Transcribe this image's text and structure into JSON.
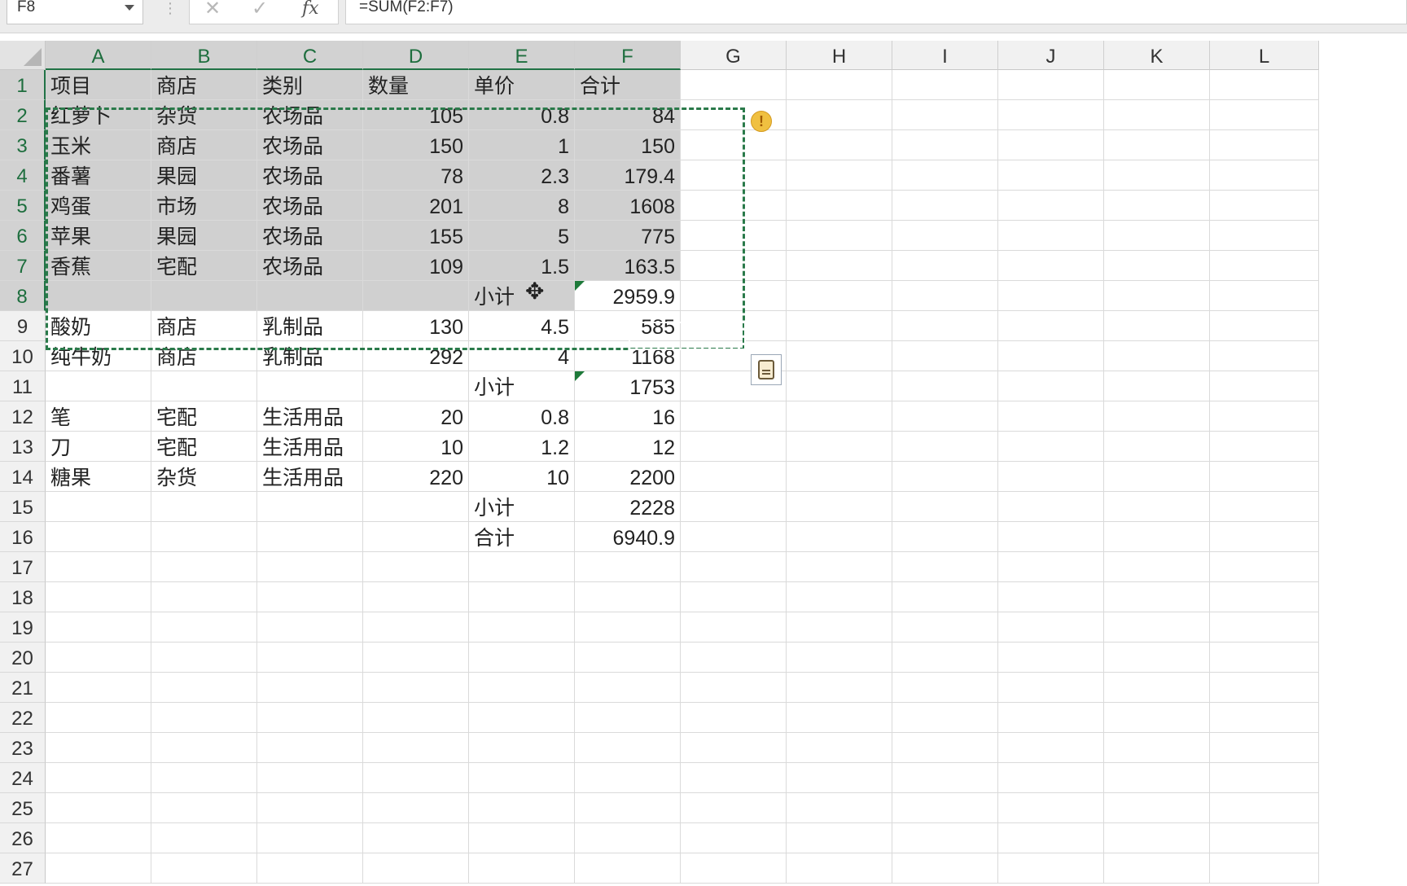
{
  "formula_bar": {
    "name_box": "F8",
    "formula": "=SUM(F2:F7)",
    "cancel_icon": "cross-icon",
    "enter_icon": "check-icon",
    "fx_label": "fx"
  },
  "columns": [
    "A",
    "B",
    "C",
    "D",
    "E",
    "F",
    "G",
    "H",
    "I",
    "J",
    "K",
    "L"
  ],
  "rows": [
    "1",
    "2",
    "3",
    "4",
    "5",
    "6",
    "7",
    "8",
    "9",
    "10",
    "11",
    "12",
    "13",
    "14",
    "15",
    "16",
    "17",
    "18",
    "19",
    "20",
    "21",
    "22",
    "23",
    "24",
    "25",
    "26",
    "27"
  ],
  "cells": [
    [
      "项目",
      "商店",
      "类别",
      "数量",
      "单价",
      "合计"
    ],
    [
      "红萝卜",
      "杂货",
      "农场品",
      "105",
      "0.8",
      "84"
    ],
    [
      "玉米",
      "商店",
      "农场品",
      "150",
      "1",
      "150"
    ],
    [
      "番薯",
      "果园",
      "农场品",
      "78",
      "2.3",
      "179.4"
    ],
    [
      "鸡蛋",
      "市场",
      "农场品",
      "201",
      "8",
      "1608"
    ],
    [
      "苹果",
      "果园",
      "农场品",
      "155",
      "5",
      "775"
    ],
    [
      "香蕉",
      "宅配",
      "农场品",
      "109",
      "1.5",
      "163.5"
    ],
    [
      "",
      "",
      "",
      "",
      "小计",
      "2959.9"
    ],
    [
      "酸奶",
      "商店",
      "乳制品",
      "130",
      "4.5",
      "585"
    ],
    [
      "纯牛奶",
      "商店",
      "乳制品",
      "292",
      "4",
      "1168"
    ],
    [
      "",
      "",
      "",
      "",
      "小计",
      "1753"
    ],
    [
      "笔",
      "宅配",
      "生活用品",
      "20",
      "0.8",
      "16"
    ],
    [
      "刀",
      "宅配",
      "生活用品",
      "10",
      "1.2",
      "12"
    ],
    [
      "糖果",
      "杂货",
      "生活用品",
      "220",
      "10",
      "2200"
    ],
    [
      "",
      "",
      "",
      "",
      "小计",
      "2228"
    ],
    [
      "",
      "",
      "",
      "",
      "合计",
      "6940.9"
    ]
  ],
  "selection": {
    "active_cell": "F8",
    "copy_range": "A1:F8"
  },
  "indicators": {
    "error_icon": "warning-icon",
    "paste_icon": "paste-options-icon",
    "cursor": "move-cursor-icon"
  }
}
